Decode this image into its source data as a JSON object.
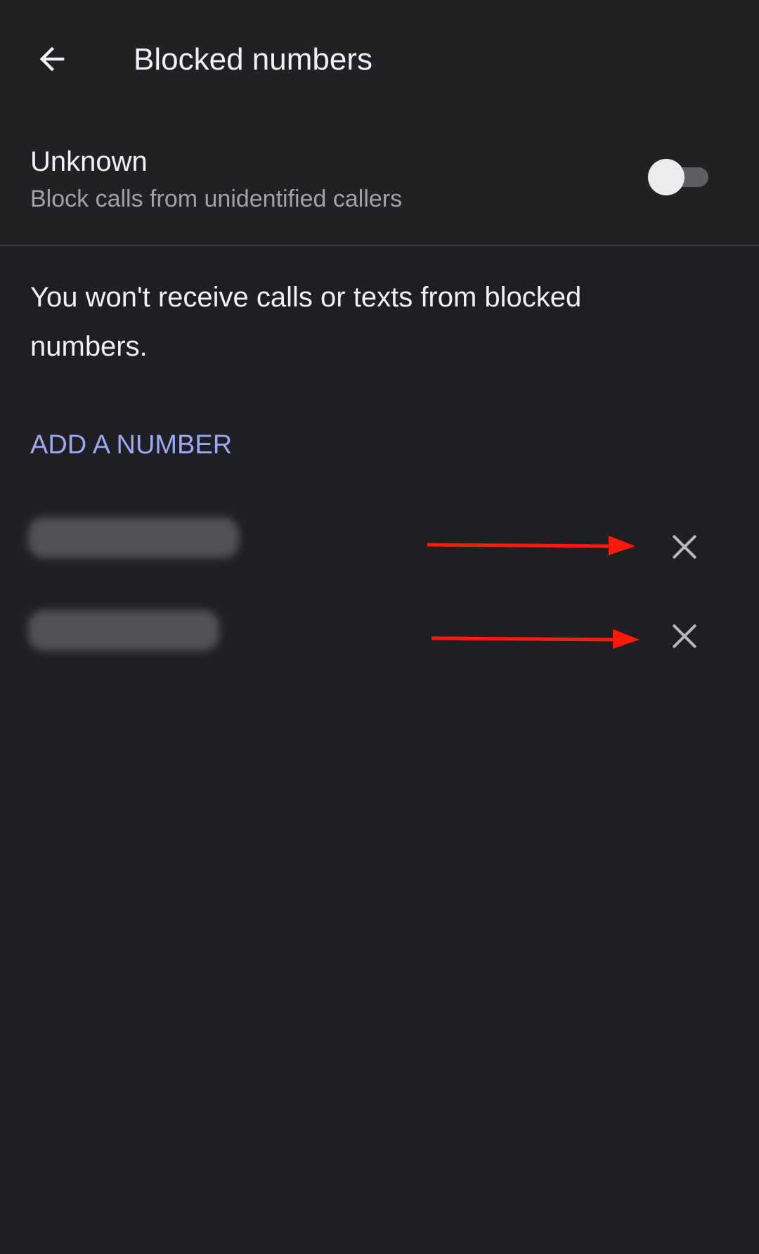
{
  "header": {
    "title": "Blocked numbers",
    "back_icon": "arrow-back-icon"
  },
  "unknown_setting": {
    "title": "Unknown",
    "subtitle": "Block calls from unidentified callers",
    "enabled": false
  },
  "info": {
    "text": "You won't receive calls or texts from blocked numbers."
  },
  "add_number": {
    "label": "ADD A NUMBER"
  },
  "blocked_numbers": [
    {
      "number": "",
      "remove_icon": "close-icon"
    },
    {
      "number": "",
      "remove_icon": "close-icon"
    }
  ],
  "colors": {
    "background": "#1f1e22",
    "accent": "#9aa8f3",
    "annotation_arrow": "#ff1a0a"
  }
}
